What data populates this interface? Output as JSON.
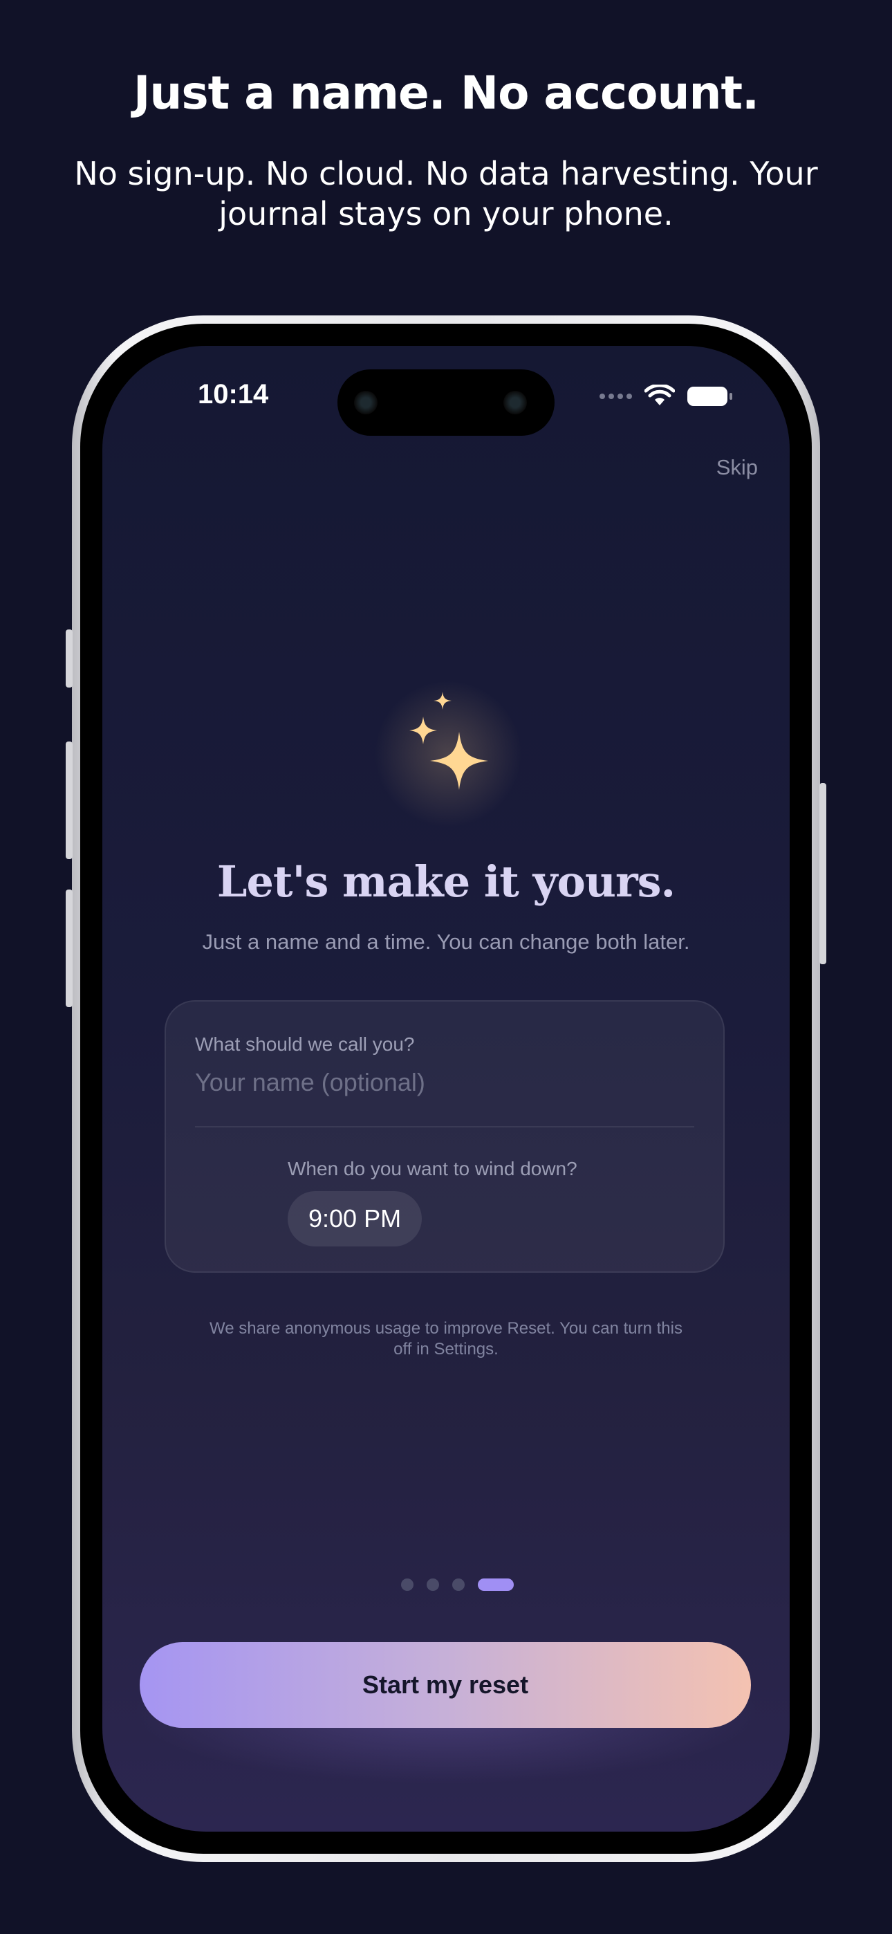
{
  "marketing": {
    "headline": "Just a name. No account.",
    "subheadline": "No sign-up. No cloud. No data harvesting. Your journal stays on your phone."
  },
  "status_bar": {
    "time": "10:14"
  },
  "onboarding": {
    "skip_label": "Skip",
    "title": "Let's make it yours.",
    "subtitle": "Just a name and a time. You can change both later.",
    "name_field": {
      "label": "What should we call you?",
      "placeholder": "Your name (optional)",
      "value": ""
    },
    "wind_down": {
      "label": "When do you want to wind down?",
      "time_value": "9:00 PM"
    },
    "privacy_note": "We share anonymous usage to improve Reset. You can turn this off in Settings.",
    "page_indicator": {
      "total": 4,
      "current": 4
    },
    "cta_label": "Start my reset"
  },
  "colors": {
    "background": "#111228",
    "accent_start": "#a595f2",
    "accent_end": "#f4c2b1",
    "sparkle": "#ffd793"
  },
  "icons": [
    "sparkles-icon",
    "wifi-icon",
    "battery-icon",
    "signal-icon"
  ]
}
